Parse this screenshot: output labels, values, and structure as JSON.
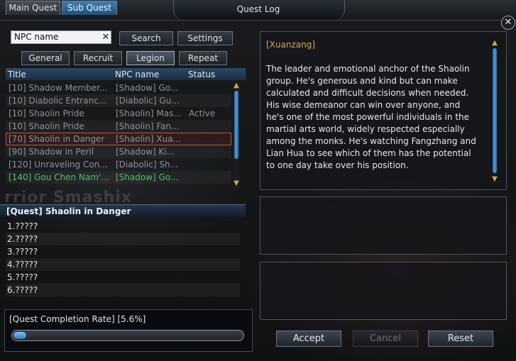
{
  "window": {
    "title": "Quest Log",
    "close_icon": "close-icon"
  },
  "tabs": {
    "main": "Main Quest",
    "sub": "Sub Quest",
    "active": "Sub Quest"
  },
  "search": {
    "value": "NPC name",
    "clear_symbol": "✕",
    "search_label": "Search",
    "settings_label": "Settings"
  },
  "filters": {
    "items": [
      "General",
      "Recruit",
      "Legion",
      "Repeat"
    ],
    "selected": "Legion"
  },
  "list": {
    "headers": {
      "title": "Title",
      "npc": "NPC name",
      "status": "Status"
    },
    "rows": [
      {
        "title": "[10] Shadow Member...",
        "npc": "[Shadow] Go...",
        "status": ""
      },
      {
        "title": "[10] Diabolic Entranc...",
        "npc": "[Diabolic] Gu...",
        "status": ""
      },
      {
        "title": "[10] Shaolin Pride",
        "npc": "[Shaolin] Mas...",
        "status": "Active"
      },
      {
        "title": "[10] Shaolin Pride",
        "npc": "[Shaolin] Fan...",
        "status": ""
      },
      {
        "title": "[70] Shaolin in Danger",
        "npc": "[Shaolin] Xua...",
        "status": ""
      },
      {
        "title": "[90] Shadow in Peril",
        "npc": "[Shadow] Ki...",
        "status": ""
      },
      {
        "title": "[120] Unraveling Con...",
        "npc": "[Diabolic] Sh...",
        "status": ""
      },
      {
        "title": "[140] Gou Chen Nam'...",
        "npc": "[Shadow] Go...",
        "status": ""
      }
    ],
    "selected_index": 4,
    "highlight_index": 7,
    "highlight_color": "#4fc35f"
  },
  "quest": {
    "heading": "[Quest] Shaolin in Danger",
    "steps": [
      "1.?????",
      "2.?????",
      "3.?????",
      "4.?????",
      "5.?????",
      "6.?????"
    ]
  },
  "progress": {
    "label": "[Quest Completion Rate]  [5.6%]",
    "value": 0.056
  },
  "detail": {
    "npc": "[Xuanzang]",
    "description": "The leader and emotional anchor of the Shaolin group. He's generous and kind but can make calculated and difficult decisions when needed. His wise demeanor can win over anyone, and he's one of the most powerful individuals in the martial arts world, widely respected especially among the monks. He's watching Fangzhang and Lian Hua to see which of them has the potential to one day take over his position."
  },
  "actions": {
    "accept": "Accept",
    "cancel": "Cancel",
    "reset": "Reset"
  },
  "background": {
    "watermark": "rrior Smashix"
  }
}
